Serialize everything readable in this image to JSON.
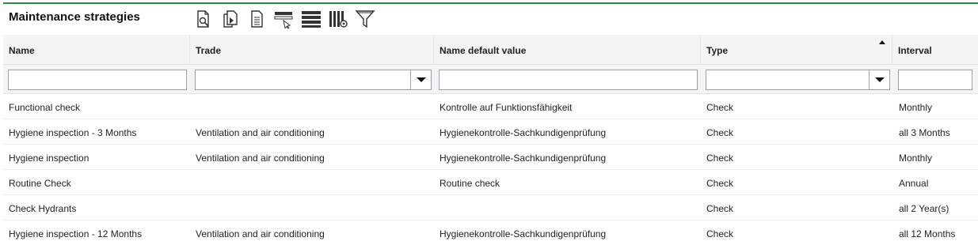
{
  "panel": {
    "title": "Maintenance strategies",
    "toolbar_icons": [
      "search-document-icon",
      "copy-document-icon",
      "document-icon",
      "edit-row-icon",
      "list-rows-icon",
      "column-settings-icon",
      "filter-icon"
    ],
    "accent_color": "#2e8b3a"
  },
  "table": {
    "columns": [
      {
        "key": "name",
        "label": "Name"
      },
      {
        "key": "trade",
        "label": "Trade"
      },
      {
        "key": "name_default",
        "label": "Name default value"
      },
      {
        "key": "type",
        "label": "Type",
        "sorted": "ascending"
      },
      {
        "key": "interval",
        "label": "Interval"
      }
    ],
    "filters": {
      "name": "",
      "trade": "",
      "name_default": "",
      "type": "",
      "interval": ""
    },
    "rows": [
      {
        "name": "Functional check",
        "trade": "",
        "name_default": "Kontrolle auf Funktionsfähigkeit",
        "type": "Check",
        "interval": "Monthly"
      },
      {
        "name": "Hygiene inspection - 3 Months",
        "trade": "Ventilation and air conditioning",
        "name_default": "Hygienekontrolle-Sachkundigenprüfung",
        "type": "Check",
        "interval": "all 3 Months"
      },
      {
        "name": "Hygiene inspection",
        "trade": "Ventilation and air conditioning",
        "name_default": "Hygienekontrolle-Sachkundigenprüfung",
        "type": "Check",
        "interval": "Monthly"
      },
      {
        "name": "Routine Check",
        "trade": "",
        "name_default": "Routine check",
        "type": "Check",
        "interval": "Annual"
      },
      {
        "name": "Check Hydrants",
        "trade": "",
        "name_default": "",
        "type": "Check",
        "interval": "all 2 Year(s)"
      },
      {
        "name": "Hygiene inspection - 12 Months",
        "trade": "Ventilation and air conditioning",
        "name_default": "Hygienekontrolle-Sachkundigenprüfung",
        "type": "Check",
        "interval": "all 12 Months"
      }
    ]
  }
}
